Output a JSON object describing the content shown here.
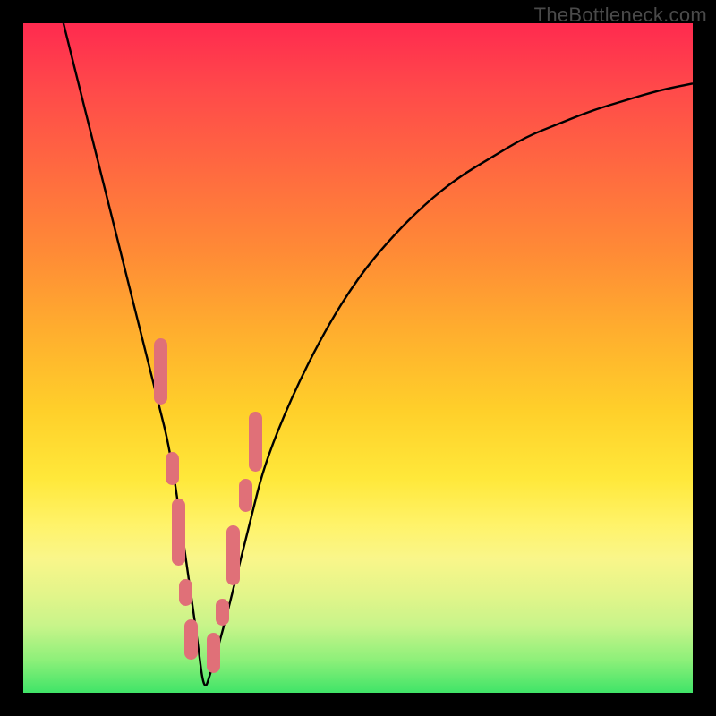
{
  "watermark": "TheBottleneck.com",
  "colors": {
    "page_bg": "#000000",
    "watermark": "#4a4a4a",
    "curve": "#000000",
    "cluster": "#e07078",
    "gradient_top": "#ff2a4f",
    "gradient_bottom": "#40e468"
  },
  "chart_data": {
    "type": "line",
    "title": "",
    "xlabel": "",
    "ylabel": "",
    "xlim": [
      0,
      100
    ],
    "ylim": [
      0,
      100
    ],
    "grid": false,
    "legend": false,
    "annotations": [
      "TheBottleneck.com"
    ],
    "x": [
      6,
      8,
      10,
      12,
      14,
      16,
      18,
      20,
      22,
      24,
      26,
      27,
      28,
      30,
      32,
      34,
      36,
      40,
      45,
      50,
      55,
      60,
      65,
      70,
      75,
      80,
      85,
      90,
      95,
      100
    ],
    "y": [
      100,
      92,
      84,
      76,
      68,
      60,
      52,
      44,
      36,
      22,
      8,
      0,
      3,
      10,
      18,
      26,
      34,
      44,
      54,
      62,
      68,
      73,
      77,
      80,
      83,
      85,
      87,
      88.5,
      90,
      91
    ],
    "vertex_x": 27,
    "clusters_left": [
      {
        "x": 20.5,
        "y": 43,
        "w": 2,
        "h": 10
      },
      {
        "x": 22.2,
        "y": 31,
        "w": 2,
        "h": 5
      },
      {
        "x": 23.2,
        "y": 19,
        "w": 2,
        "h": 10
      },
      {
        "x": 24.3,
        "y": 13,
        "w": 2,
        "h": 4
      },
      {
        "x": 25.1,
        "y": 5,
        "w": 2,
        "h": 6
      }
    ],
    "clusters_right": [
      {
        "x": 28.4,
        "y": 3,
        "w": 2,
        "h": 6
      },
      {
        "x": 29.8,
        "y": 10,
        "w": 2,
        "h": 4
      },
      {
        "x": 31.3,
        "y": 16,
        "w": 2,
        "h": 9
      },
      {
        "x": 33.2,
        "y": 27,
        "w": 2,
        "h": 5
      },
      {
        "x": 34.7,
        "y": 33,
        "w": 2,
        "h": 9
      }
    ],
    "note": "x and y in 0–100 chart units; y=0 is bottom. cluster x,y,w,h in same units (y is bottom edge from chart bottom)."
  }
}
